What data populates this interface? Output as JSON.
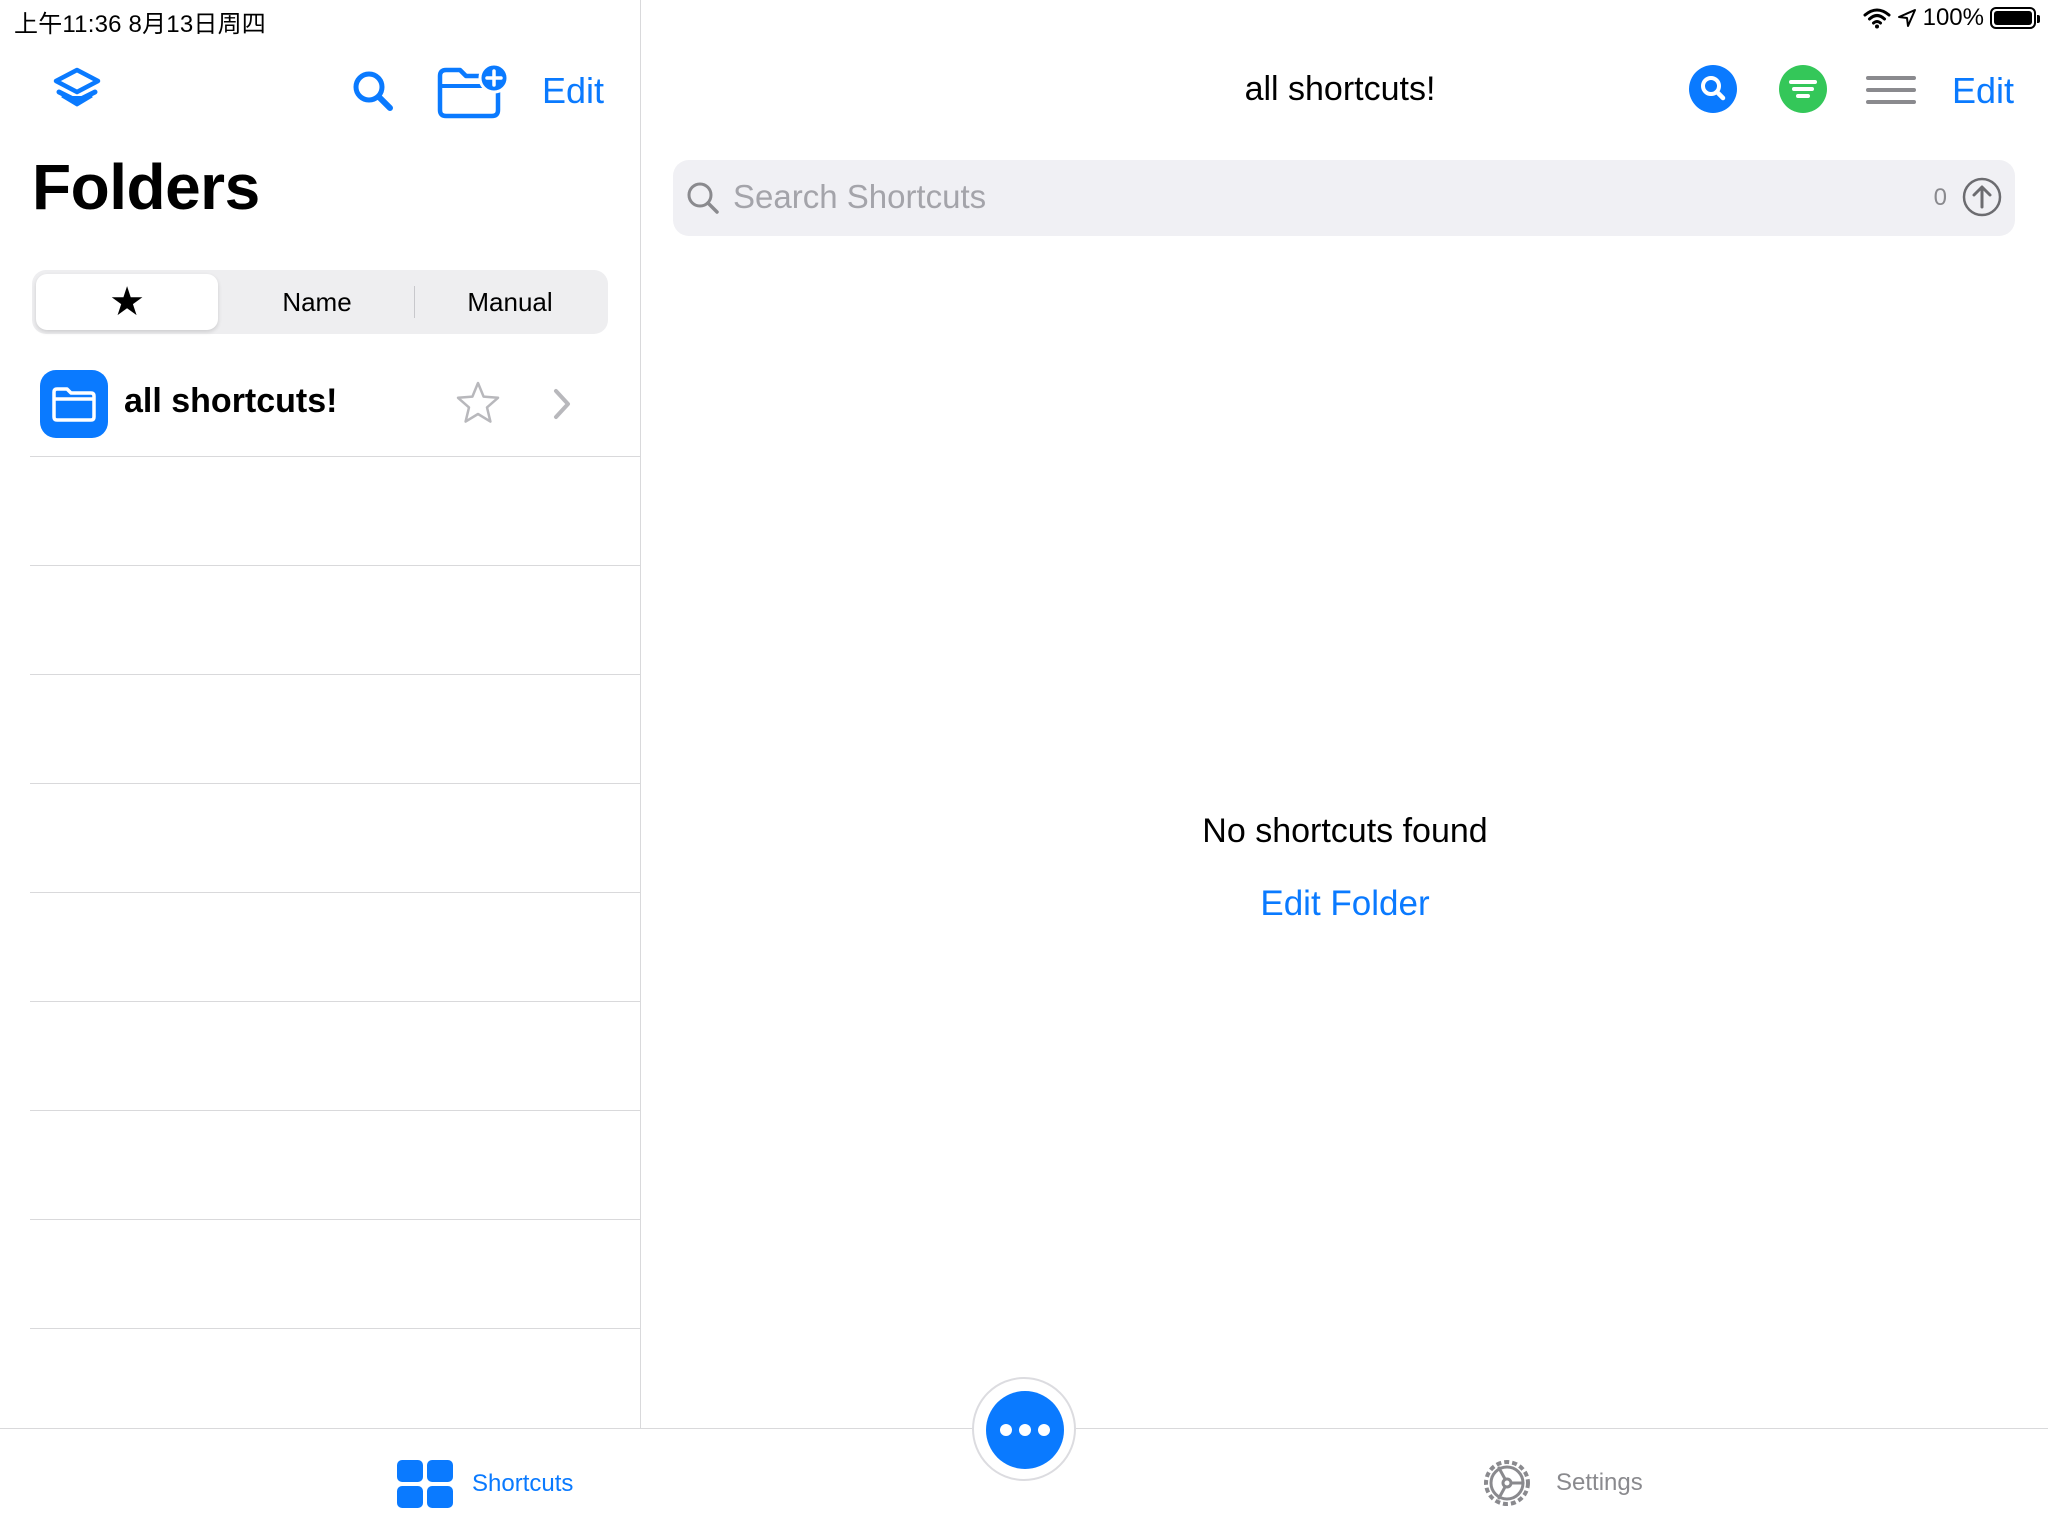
{
  "status_bar": {
    "time_date": "上午11:36   8月13日周四",
    "battery": "100%"
  },
  "left_panel": {
    "title": "Folders",
    "edit_label": "Edit",
    "sort": {
      "options": [
        "★",
        "Name",
        "Manual"
      ],
      "selected": "★"
    },
    "folders": [
      {
        "name": "all shortcuts!",
        "favorite": false
      }
    ]
  },
  "right_panel": {
    "title": "all shortcuts!",
    "edit_label": "Edit",
    "search": {
      "placeholder": "Search Shortcuts",
      "count": "0"
    },
    "empty_message": "No shortcuts found",
    "edit_folder_label": "Edit Folder"
  },
  "tab_bar": {
    "tabs": [
      {
        "label": "Shortcuts",
        "icon": "grid-icon",
        "active": true
      },
      {
        "label": "Settings",
        "icon": "gear-icon",
        "active": false
      }
    ]
  },
  "colors": {
    "accent": "#0a7aff",
    "green": "#34c759",
    "separator": "#d9d9db",
    "muted": "#8a8a8e"
  }
}
